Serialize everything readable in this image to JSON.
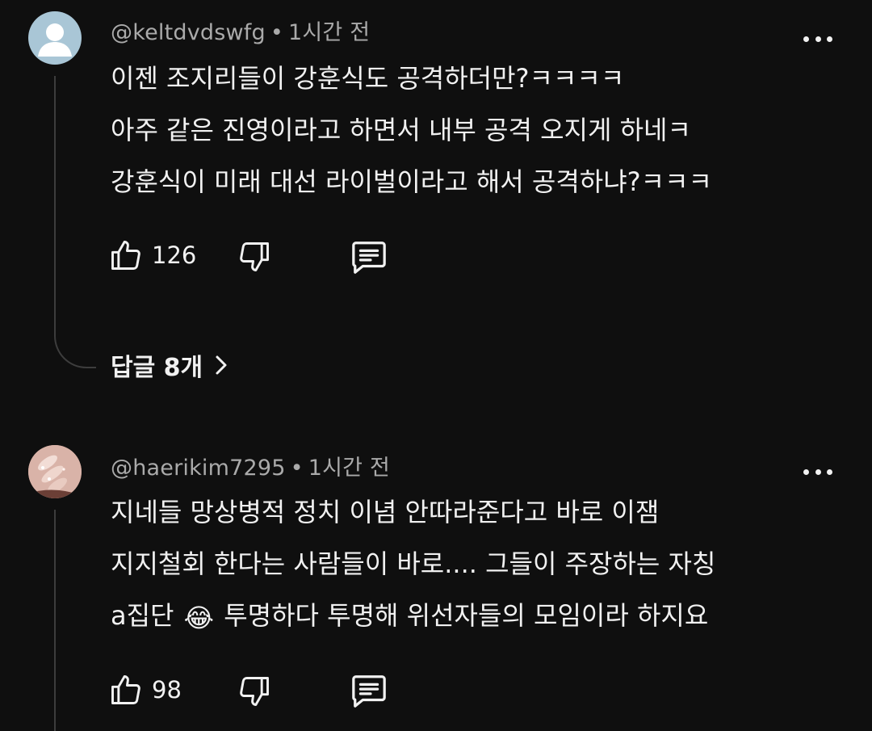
{
  "comments": [
    {
      "handle": "@keltdvdswfg",
      "separator": "•",
      "time": "1시간 전",
      "lines": [
        "이젠 조지리들이 강훈식도 공격하더만?ㅋㅋㅋㅋ",
        "아주 같은 진영이라고 하면서 내부 공격 오지게 하네ㅋ",
        "강훈식이 미래 대선 라이벌이라고 해서 공격하냐?ㅋㅋㅋ"
      ],
      "likes": "126",
      "replies_label": "답글 8개"
    },
    {
      "handle": "@haerikim7295",
      "separator": "•",
      "time": "1시간 전",
      "lines": [
        "지네들 망상병적 정치 이념 안따라준다고 바로 이잼",
        "지지철회 한다는 사람들이 바로.... 그들이 주장하는 자칭"
      ],
      "line3_before": "a집단",
      "line3_emoji": "😂",
      "line3_after": "투명하다 투명해 위선자들의 모임이라 하지요",
      "likes": "98"
    }
  ],
  "icons": {
    "more": "more-vertical-dots-icon",
    "like": "thumb-up-icon",
    "dislike": "thumb-down-icon",
    "reply": "comment-icon",
    "chevron": "chevron-right-icon"
  },
  "colors": {
    "background": "#0f0f0f",
    "text": "#f1f1f1",
    "meta": "#aaaaaa",
    "thread_line": "#3d3d3d"
  }
}
